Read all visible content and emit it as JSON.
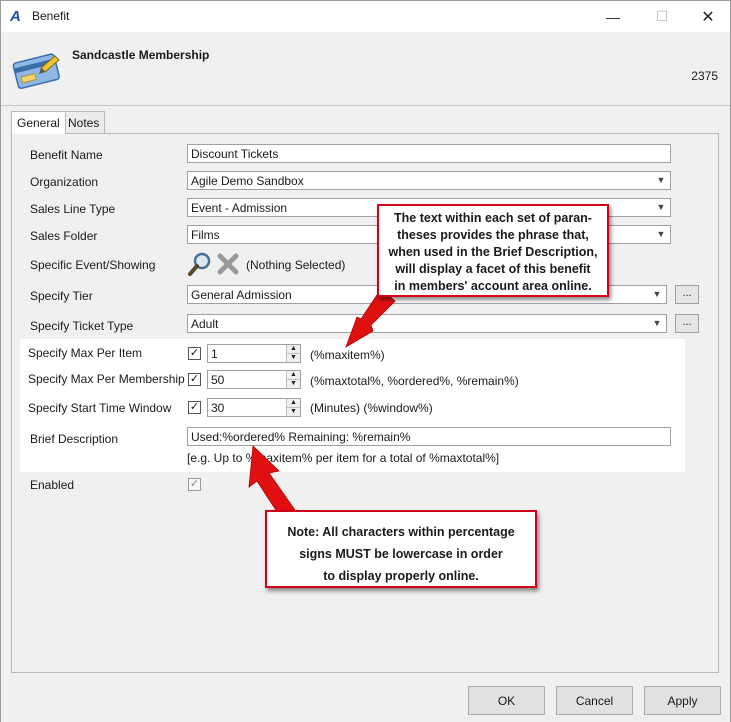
{
  "window": {
    "app_logo": "A",
    "title": "Benefit",
    "minimize_glyph": "—",
    "maximize_glyph": "☐",
    "close_glyph": "✕"
  },
  "header": {
    "name": "Sandcastle Membership",
    "id": "2375"
  },
  "tabs": [
    {
      "label": "General",
      "active": true
    },
    {
      "label": "Notes",
      "active": false
    }
  ],
  "form": {
    "benefit_name": {
      "label": "Benefit Name",
      "value": "Discount Tickets"
    },
    "organization": {
      "label": "Organization",
      "value": "Agile Demo Sandbox"
    },
    "sales_line_type": {
      "label": "Sales Line Type",
      "value": "Event - Admission"
    },
    "sales_folder": {
      "label": "Sales Folder",
      "value": "Films"
    },
    "specific_event": {
      "label": "Specific Event/Showing",
      "value": "(Nothing Selected)"
    },
    "specify_tier": {
      "label": "Specify Tier",
      "value": "General Admission",
      "button": "..."
    },
    "ticket_type": {
      "label": "Specify Ticket Type",
      "value": "Adult",
      "button": "..."
    },
    "max_per_item": {
      "label": "Specify Max Per Item",
      "checked": true,
      "value": "1",
      "hint": "(%maxitem%)"
    },
    "max_per_membership": {
      "label": "Specify Max Per Membership",
      "checked": true,
      "value": "50",
      "hint": "(%maxtotal%, %ordered%, %remain%)"
    },
    "start_time_window": {
      "label": "Specify Start Time Window",
      "checked": true,
      "value": "30",
      "hint": "(Minutes) (%window%)"
    },
    "brief_description": {
      "label": "Brief Description",
      "value": "Used:%ordered% Remaining: %remain%",
      "example": "[e.g. Up to %maxitem% per item for a total of %maxtotal%]"
    },
    "enabled": {
      "label": "Enabled",
      "checked": true
    }
  },
  "callouts": {
    "top": [
      "The text within each set of paran-",
      "theses provides the phrase that,",
      "when used in the Brief Description,",
      "will display a facet of this benefit",
      "in members' account area online."
    ],
    "bottom": [
      "Note: All characters within percentage",
      "signs MUST be lowercase in order",
      "to display properly online."
    ]
  },
  "buttons": {
    "ok": "OK",
    "cancel": "Cancel",
    "apply": "Apply"
  },
  "colors": {
    "callout_border": "#d0011b",
    "arrow": "#e01010",
    "logo": "#1f4fa8"
  }
}
